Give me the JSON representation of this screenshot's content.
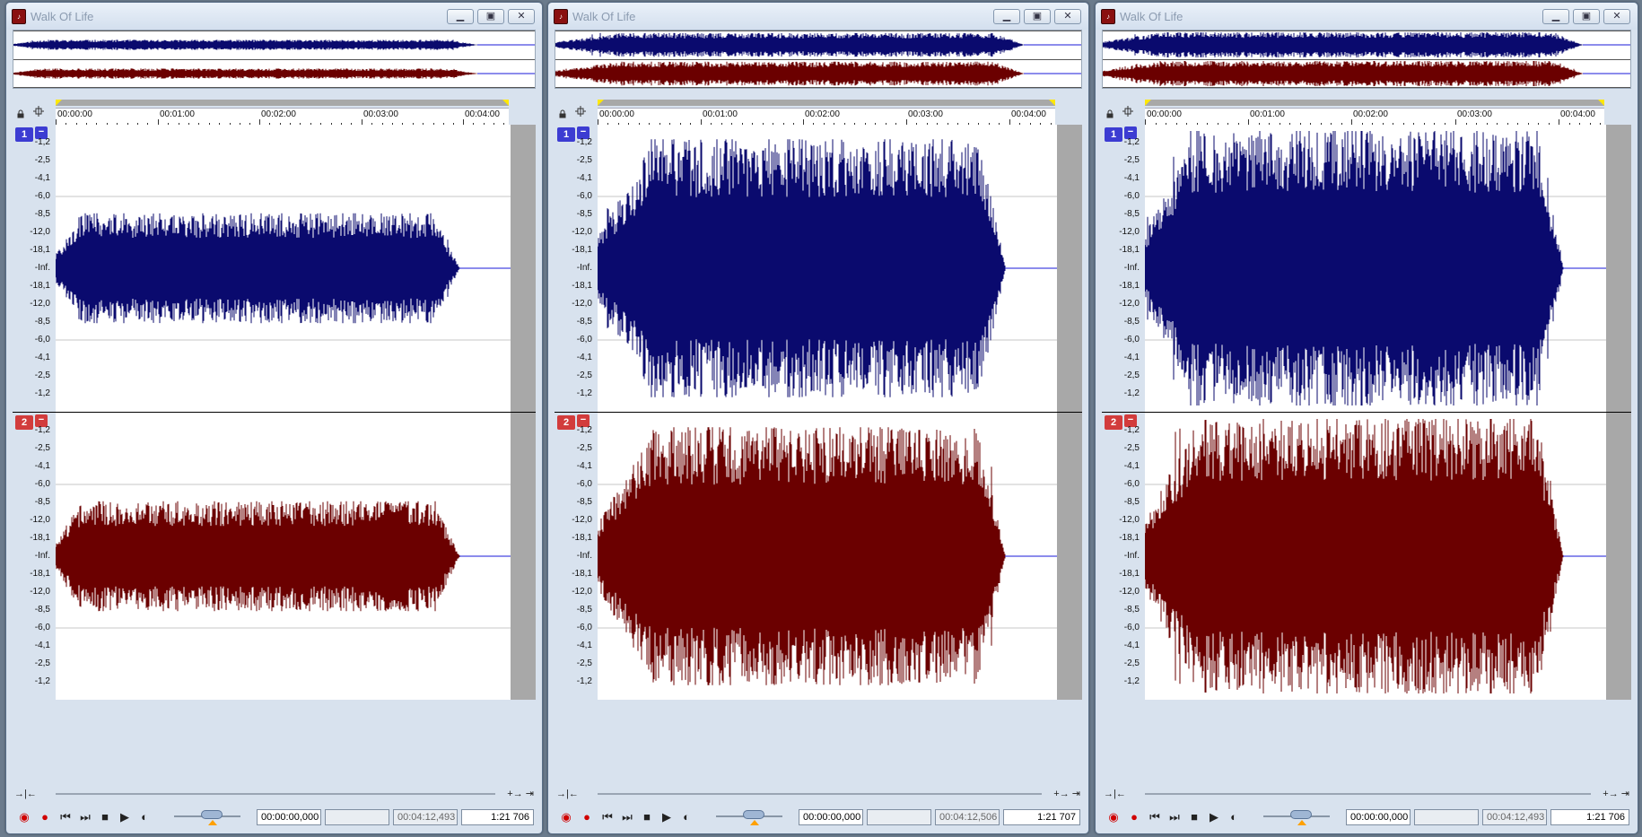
{
  "colors": {
    "channel1": "#0a0a6e",
    "channel2": "#6b0000",
    "badge1": "#3c3cd2",
    "badge2": "#d23c3c",
    "grid": "#c7c7c7",
    "endArea": "#a8a8a8"
  },
  "icons": {
    "lock": "lock-icon",
    "snap": "snap-icon",
    "minimize": "minimize-icon",
    "maximize": "maximize-icon",
    "close": "close-icon",
    "record_options": "record-options-icon",
    "record": "record-icon",
    "go_start": "go-to-start-icon",
    "go_end": "go-to-end-icon",
    "stop": "stop-icon",
    "play": "play-icon",
    "play_all": "play-all-icon"
  },
  "windows": [
    {
      "title": "Walk Of Life",
      "ruler_ticks": [
        "00:00:00",
        "00:01:00",
        "00:02:00",
        "00:03:00",
        "00:04:00"
      ],
      "db_scale": [
        "-1,2",
        "-2,5",
        "-4,1",
        "-6,0",
        "-8,5",
        "-12,0",
        "-18,1",
        "-Inf.",
        "-18,1",
        "-12,0",
        "-8,5",
        "-6,0",
        "-4,1",
        "-2,5",
        "-1,2"
      ],
      "channels": [
        "1",
        "2"
      ],
      "waveform_profile": {
        "peak_level": 0.4,
        "attack_fraction": 0.06,
        "release_fraction": 0.88
      },
      "transport": {
        "position": "00:00:00,000",
        "selection": "",
        "length": "00:04:12,493",
        "zoom": "1:21 706"
      }
    },
    {
      "title": "Walk Of Life",
      "ruler_ticks": [
        "00:00:00",
        "00:01:00",
        "00:02:00",
        "00:03:00",
        "00:04:00"
      ],
      "db_scale": [
        "-1,2",
        "-2,5",
        "-4,1",
        "-6,0",
        "-8,5",
        "-12,0",
        "-18,1",
        "-Inf.",
        "-18,1",
        "-12,0",
        "-8,5",
        "-6,0",
        "-4,1",
        "-2,5",
        "-1,2"
      ],
      "channels": [
        "1",
        "2"
      ],
      "waveform_profile": {
        "peak_level": 0.94,
        "attack_fraction": 0.13,
        "release_fraction": 0.88
      },
      "transport": {
        "position": "00:00:00,000",
        "selection": "",
        "length": "00:04:12,506",
        "zoom": "1:21 707"
      }
    },
    {
      "title": "Walk Of Life",
      "ruler_ticks": [
        "00:00:00",
        "00:01:00",
        "00:02:00",
        "00:03:00",
        "00:04:00"
      ],
      "db_scale": [
        "-1,2",
        "-2,5",
        "-4,1",
        "-6,0",
        "-8,5",
        "-12,0",
        "-18,1",
        "-Inf.",
        "-18,1",
        "-12,0",
        "-8,5",
        "-6,0",
        "-4,1",
        "-2,5",
        "-1,2"
      ],
      "channels": [
        "1",
        "2"
      ],
      "waveform_profile": {
        "peak_level": 1.0,
        "attack_fraction": 0.12,
        "release_fraction": 0.9
      },
      "transport": {
        "position": "00:00:00,000",
        "selection": "",
        "length": "00:04:12,493",
        "zoom": "1:21 706"
      }
    }
  ]
}
